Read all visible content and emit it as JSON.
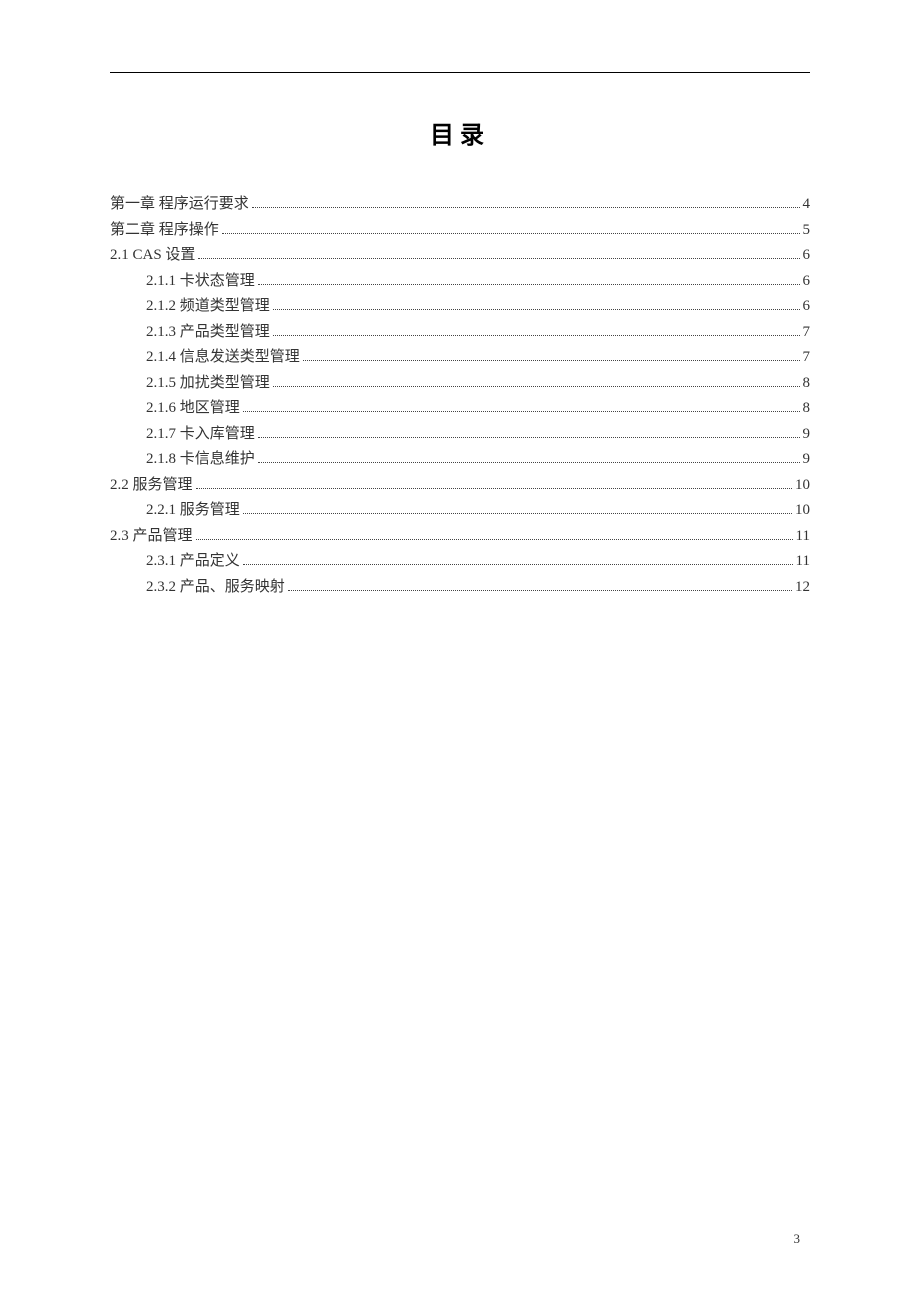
{
  "title": "目录",
  "page_number": "3",
  "toc": [
    {
      "indent": 0,
      "label": "第一章    程序运行要求",
      "page": "4"
    },
    {
      "indent": 0,
      "label": "第二章 程序操作",
      "page": "5"
    },
    {
      "indent": 0,
      "label": "2.1 CAS 设置",
      "page": "6"
    },
    {
      "indent": 1,
      "label": "2.1.1   卡状态管理",
      "page": "6"
    },
    {
      "indent": 1,
      "label": "2.1.2   频道类型管理",
      "page": "6"
    },
    {
      "indent": 1,
      "label": "2.1.3   产品类型管理",
      "page": "7"
    },
    {
      "indent": 1,
      "label": "2.1.4 信息发送类型管理",
      "page": "7"
    },
    {
      "indent": 1,
      "label": "2.1.5 加扰类型管理",
      "page": "8"
    },
    {
      "indent": 1,
      "label": "2.1.6 地区管理",
      "page": "8"
    },
    {
      "indent": 1,
      "label": "2.1.7 卡入库管理",
      "page": "9"
    },
    {
      "indent": 1,
      "label": "2.1.8 卡信息维护",
      "page": "9"
    },
    {
      "indent": 0,
      "label": "2.2 服务管理",
      "page": "10"
    },
    {
      "indent": 1,
      "label": "2.2.1 服务管理",
      "page": "10"
    },
    {
      "indent": 0,
      "label": "2.3 产品管理",
      "page": "11"
    },
    {
      "indent": 1,
      "label": "2.3.1 产品定义",
      "page": "11"
    },
    {
      "indent": 1,
      "label": "2.3.2 产品、服务映射",
      "page": "12"
    }
  ]
}
